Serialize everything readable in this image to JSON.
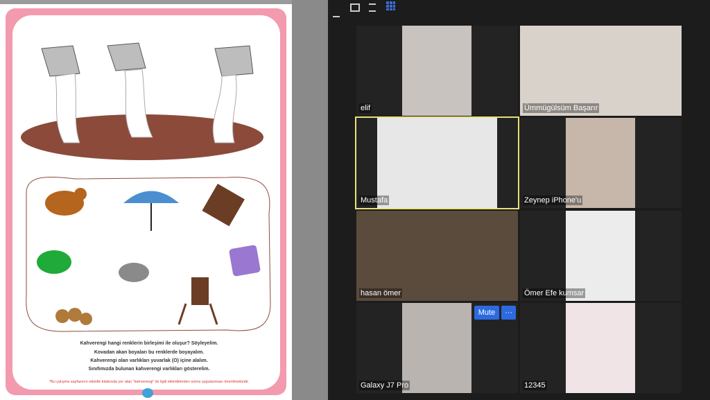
{
  "worksheet": {
    "lines": [
      "Kahverengi hangi renklerin birleşimi ile oluşur? Söyleyelim.",
      "Kovadan akan boyaları bu renklerde boyayalım.",
      "Kahverengi olan varlıkları yuvarlak (O) içine alalım.",
      "Sınıfımızda bulunan kahverengi varlıkları gösterelim."
    ],
    "note": "*Bu çalışma sayfasının etkinlik kitabında yer alan \"kahverengi\" ile ilgili etkinliklerden sonra uygulanması önerilmektedir.",
    "items": [
      "squirrel",
      "umbrella",
      "chocolate",
      "cap",
      "pigeon",
      "purse",
      "walnuts",
      "chair"
    ],
    "colors": {
      "frame": "#f39aae",
      "puddle": "#8b4a3a",
      "paint": "#ffffff"
    }
  },
  "toolbar": {
    "icons": [
      "minimize-icon",
      "window-icon",
      "split-icon",
      "grid-view-icon"
    ]
  },
  "participants": [
    {
      "name": "elif",
      "cam": "#c9c3c0"
    },
    {
      "name": "Ümmügülsüm Başarır",
      "cam": "#d8d2cb"
    },
    {
      "name": "Mustafa",
      "cam": "#e7e7e7",
      "active": true
    },
    {
      "name": "Zeynep iPhone'u",
      "cam": "#c7b7aa"
    },
    {
      "name": "hasan ömer",
      "cam": "#5a4b3c"
    },
    {
      "name": "Ömer Efe kumsar",
      "cam": "#ececec"
    },
    {
      "name": "Galaxy J7 Pro",
      "cam": "#b9b4b0"
    },
    {
      "name": "12345",
      "cam": "#f0e4e6"
    }
  ],
  "controls": {
    "mute_label": "Mute",
    "more_label": "···"
  }
}
